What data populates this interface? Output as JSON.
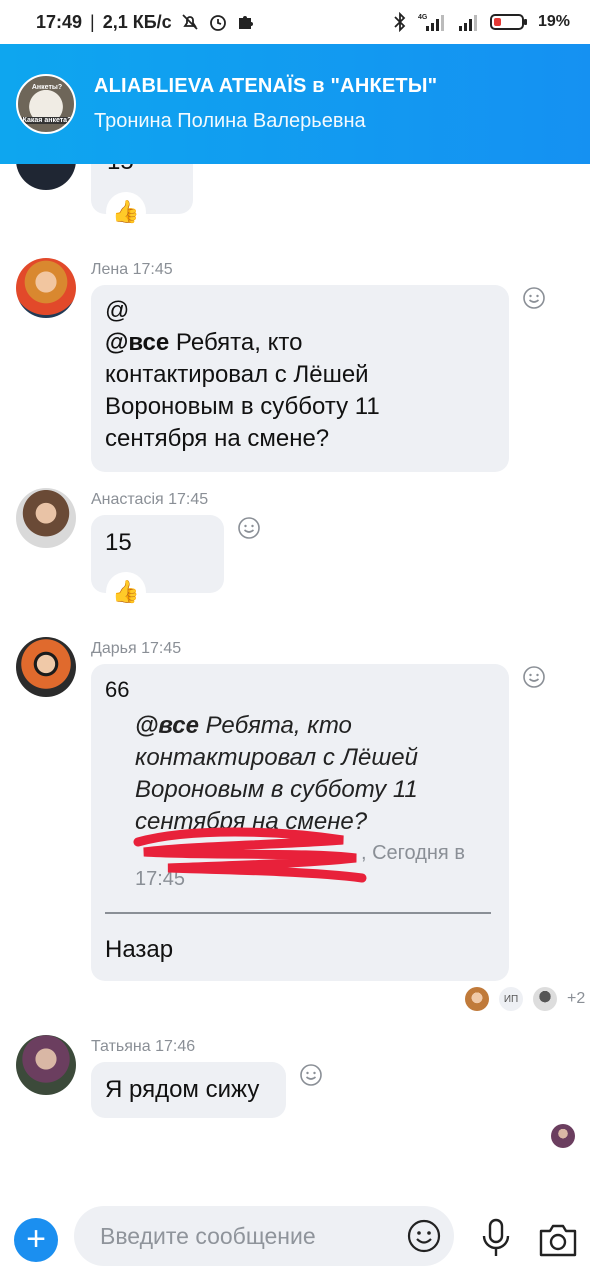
{
  "status_bar": {
    "time": "17:49",
    "speed": "2,1 КБ/с",
    "network": "4G",
    "battery": "19%"
  },
  "header": {
    "title": "ALIABLIEVA ATENAÏS в \"АНКЕТЫ\"",
    "subtitle": "Тронина Полина Валерьевна",
    "avatar_caption_top": "Анкеты?",
    "avatar_caption_bottom": "Какая анкета?"
  },
  "messages": [
    {
      "id": "partial",
      "text": "15",
      "reaction": "👍"
    },
    {
      "id": "lena",
      "sender": "Лена 17:45",
      "line1": "@",
      "mention": "@все",
      "text_after_mention": " Ребята, кто",
      "text_rest": "контактировал с Лёшей Вороновым в субботу 11 сентября на смене?"
    },
    {
      "id": "anastasia",
      "sender": "Анастасія 17:45",
      "text": "15",
      "reaction": "👍"
    },
    {
      "id": "darya",
      "sender": "Дарья 17:45",
      "quote_mark": "66",
      "quote_mention": "@все",
      "quote_after_mention": " Ребята, кто",
      "quote_rest": "контактировал с Лёшей Вороновым в субботу 11 сентября на смене?",
      "quote_meta_1": ", Сегодня в",
      "quote_meta_2": "17:45",
      "text": "Назар",
      "read_initials": "ИП",
      "read_more": "+2"
    },
    {
      "id": "tatyana",
      "sender": "Татьяна 17:46",
      "text": "Я рядом сижу"
    }
  ],
  "composer": {
    "add_label": "+",
    "placeholder": "Введите сообщение"
  },
  "colors": {
    "header_start": "#0ea6ef",
    "header_end": "#1591f2",
    "bubble": "#eef0f4",
    "accent": "#1b8ff0",
    "meta": "#8a8f96",
    "scribble": "#e8213a"
  },
  "icons": [
    "do-not-disturb-icon",
    "alarm-icon",
    "app-icon",
    "bluetooth-icon",
    "signal-icon",
    "battery-icon",
    "smile-icon",
    "thumbs-up-icon",
    "plus-icon",
    "mic-icon",
    "camera-icon"
  ]
}
